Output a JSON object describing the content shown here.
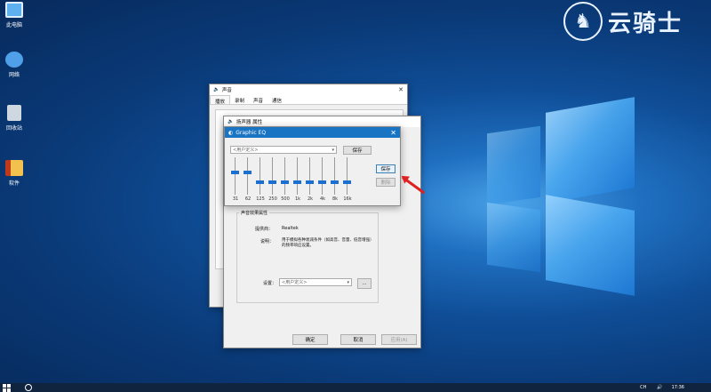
{
  "desktop": {
    "icons": [
      {
        "label": "此电脑",
        "icon": "computer-icon"
      },
      {
        "label": "网络",
        "icon": "network-icon"
      },
      {
        "label": "回收站",
        "icon": "recycle-bin-icon"
      },
      {
        "label": "软件",
        "icon": "folder-icon"
      }
    ],
    "watermark": {
      "text": "云骑士",
      "icon": "knight-logo-icon"
    }
  },
  "sound_window": {
    "title": "声音",
    "tabs": [
      "播放",
      "录制",
      "声音",
      "通信"
    ],
    "active_tab": "播放"
  },
  "speaker_props": {
    "title": "扬声器 属性",
    "group_label": "声音效果属性",
    "provider_label": "提供商：",
    "provider_value": "Realtek",
    "desc_label": "说明：",
    "desc_value": "用于模拟各种衰减条件（如高音、音量、低音增强）的频率响应设置。",
    "settings_label": "设置：",
    "settings_value": "<用户定义>",
    "more_button": "...",
    "ok_button": "确定",
    "cancel_button": "取消",
    "apply_button": "应用(A)"
  },
  "graphic_eq": {
    "title": "Graphic EQ",
    "preset_value": "<用户定义>",
    "save_button": "保存",
    "load_button": "保存",
    "delete_button": "删除",
    "bands": [
      {
        "freq": "31",
        "level": 0.5
      },
      {
        "freq": "62",
        "level": 0.5
      },
      {
        "freq": "125",
        "level": 0.2
      },
      {
        "freq": "250",
        "level": 0.2
      },
      {
        "freq": "500",
        "level": 0.2
      },
      {
        "freq": "1k",
        "level": 0.2
      },
      {
        "freq": "2k",
        "level": 0.2
      },
      {
        "freq": "4k",
        "level": 0.2
      },
      {
        "freq": "8k",
        "level": 0.2
      },
      {
        "freq": "16k",
        "level": 0.2
      }
    ]
  },
  "taskbar": {
    "time": "17:36",
    "tray": "CH"
  },
  "colors": {
    "accent": "#1a74c4",
    "arrow": "#e02020"
  }
}
